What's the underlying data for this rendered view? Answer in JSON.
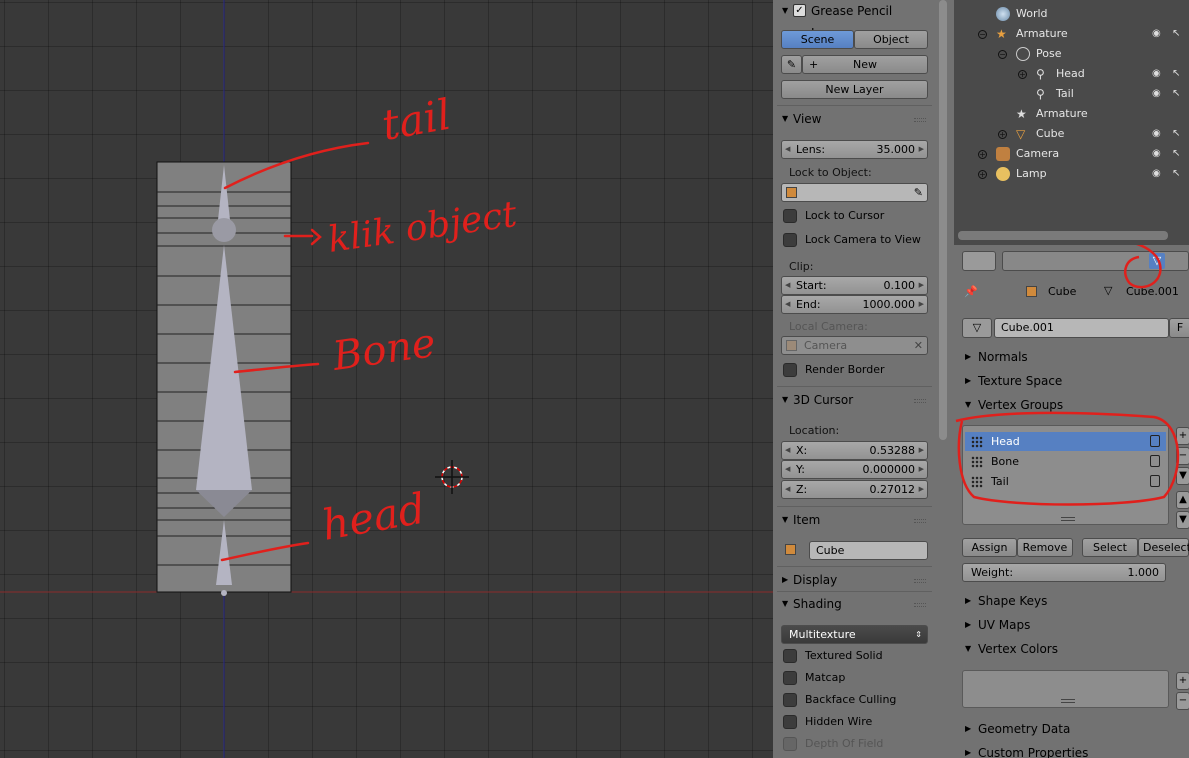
{
  "viewport": {
    "annotations": [
      "tail",
      "klik object",
      "Bone",
      "head"
    ]
  },
  "properties": {
    "grease_pencil": {
      "title": "Grease Pencil Layers",
      "scene_label": "Scene",
      "object_label": "Object",
      "new_label": "New",
      "new_layer_label": "New Layer"
    },
    "view": {
      "title": "View",
      "lens_key": "Lens:",
      "lens_value": "35.000",
      "lock_to_object": "Lock to Object:",
      "lock_to_cursor": "Lock to Cursor",
      "lock_camera": "Lock Camera to View",
      "clip": "Clip:",
      "start_key": "Start:",
      "start_value": "0.100",
      "end_key": "End:",
      "end_value": "1000.000",
      "local_camera": "Local Camera:",
      "camera_placeholder": "Camera",
      "render_border": "Render Border"
    },
    "cursor": {
      "title": "3D Cursor",
      "location": "Location:",
      "x_key": "X:",
      "x_value": "0.53288",
      "y_key": "Y:",
      "y_value": "0.000000",
      "z_key": "Z:",
      "z_value": "0.27012"
    },
    "item": {
      "title": "Item",
      "name": "Cube"
    },
    "display": {
      "title": "Display"
    },
    "shading": {
      "title": "Shading",
      "mode": "Multitexture",
      "textured_solid": "Textured Solid",
      "matcap": "Matcap",
      "backface": "Backface Culling",
      "hidden_wire": "Hidden Wire",
      "depth_of_field": "Depth Of Field"
    }
  },
  "outliner": {
    "rows": [
      "World",
      "Armature",
      "Pose",
      "Head",
      "Tail",
      "Armature",
      "Cube",
      "Camera",
      "Lamp"
    ]
  },
  "data_panel": {
    "breadcrumb_object": "Cube",
    "breadcrumb_mesh": "Cube.001",
    "mesh_name": "Cube.001",
    "fake_user": "F",
    "normals": "Normals",
    "texture_space": "Texture Space",
    "vertex_groups": "Vertex Groups",
    "groups": [
      "Head",
      "Bone",
      "Tail"
    ],
    "assign": "Assign",
    "remove": "Remove",
    "select": "Select",
    "deselect": "Deselect",
    "weight_key": "Weight:",
    "weight_value": "1.000",
    "shape_keys": "Shape Keys",
    "uv_maps": "UV Maps",
    "vertex_colors": "Vertex Colors",
    "geometry_data": "Geometry Data",
    "custom_properties": "Custom Properties"
  },
  "colors": {
    "annotation": "#e0201c",
    "selected": "#5680c2",
    "x_axis": "#8a2b2b",
    "y_axis": "#2b2b8a"
  }
}
